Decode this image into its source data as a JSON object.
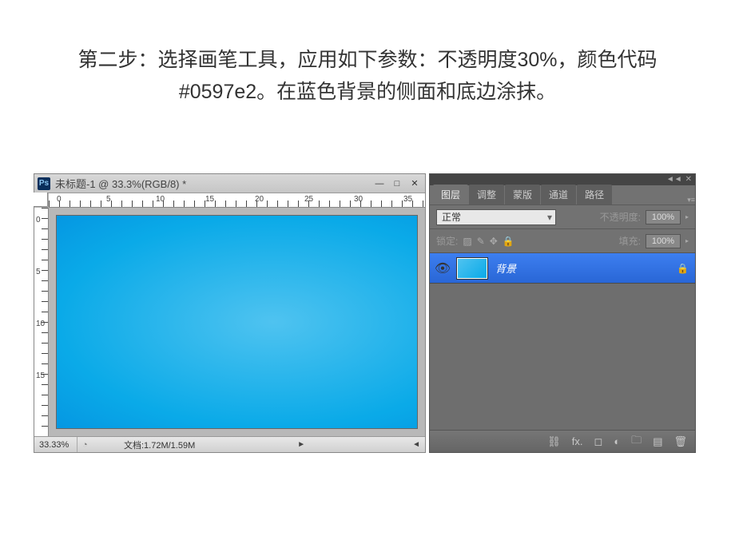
{
  "instruction": "第二步：选择画笔工具，应用如下参数：不透明度30%，颜色代码#0597e2。在蓝色背景的侧面和底边涂抹。",
  "document": {
    "ps_icon": "Ps",
    "title": "未标题-1 @ 33.3%(RGB/8) *",
    "win_minimize": "—",
    "win_maximize": "□",
    "win_close": "✕",
    "ruler_h": [
      "0",
      "5",
      "10",
      "15",
      "20",
      "25",
      "30",
      "35"
    ],
    "ruler_v": [
      "0",
      "5",
      "10",
      "15"
    ],
    "zoom": "33.33%",
    "doc_info": "文档:1.72M/1.59M",
    "scroll_l": "◄",
    "scroll_r": "►"
  },
  "panel": {
    "collapse": "◄◄",
    "close": "✕",
    "tabs": [
      "图层",
      "调整",
      "蒙版",
      "通道",
      "路径"
    ],
    "blend_mode": "正常",
    "opacity_label": "不透明度:",
    "opacity_value": "100%",
    "lock_label": "锁定:",
    "fill_label": "填充:",
    "fill_value": "100%",
    "lock_icons": {
      "px": "▨",
      "brush": "✎",
      "move": "✥",
      "all": "🔒"
    },
    "layer": {
      "eye": "👁",
      "name": "背景",
      "lock": "🔒"
    },
    "footer": {
      "link": "⛓",
      "fx": "fx.",
      "mask": "◻",
      "adjust": "◐",
      "group": "🗀",
      "new": "▤",
      "trash": "🗑"
    }
  }
}
